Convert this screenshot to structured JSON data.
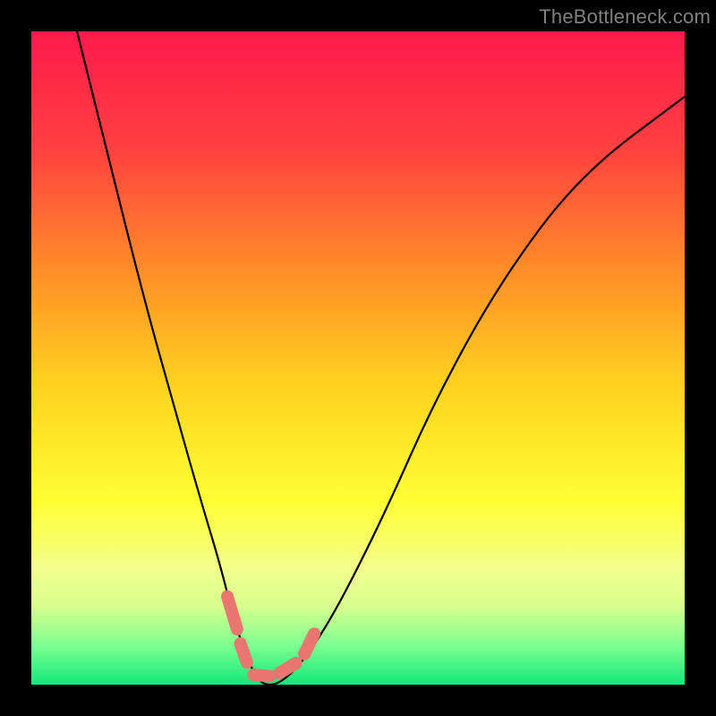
{
  "watermark": "TheBottleneck.com",
  "chart_data": {
    "type": "line",
    "title": "",
    "xlabel": "",
    "ylabel": "",
    "xlim": [
      0,
      100
    ],
    "ylim": [
      0,
      100
    ],
    "grid": false,
    "legend": false,
    "series": [
      {
        "name": "curve",
        "x": [
          7,
          12,
          17,
          22,
          26,
          29,
          31,
          33,
          35,
          38,
          42,
          47,
          54,
          62,
          72,
          84,
          100
        ],
        "y": [
          100,
          80,
          60,
          42,
          28,
          18,
          10,
          4,
          0,
          0,
          4,
          12,
          26,
          44,
          62,
          78,
          90
        ]
      }
    ],
    "markers": {
      "note": "highlighted pink segments near the curve minimum",
      "segments": [
        {
          "x0": 30.0,
          "y0": 13.5,
          "x1": 31.5,
          "y1": 8.5
        },
        {
          "x0": 32.0,
          "y0": 6.3,
          "x1": 33.0,
          "y1": 3.4
        },
        {
          "x0": 34.0,
          "y0": 1.5,
          "x1": 36.5,
          "y1": 1.3
        },
        {
          "x0": 38.0,
          "y0": 1.8,
          "x1": 40.5,
          "y1": 3.3
        },
        {
          "x0": 41.8,
          "y0": 4.7,
          "x1": 43.3,
          "y1": 7.8
        }
      ]
    },
    "background_gradient": {
      "direction": "top-to-bottom",
      "stops": [
        {
          "pos": 0.0,
          "color": "#ff1a4b"
        },
        {
          "pos": 0.18,
          "color": "#ff4040"
        },
        {
          "pos": 0.36,
          "color": "#ff8b28"
        },
        {
          "pos": 0.54,
          "color": "#ffd21e"
        },
        {
          "pos": 0.72,
          "color": "#ffff33"
        },
        {
          "pos": 0.82,
          "color": "#f3ff8a"
        },
        {
          "pos": 0.88,
          "color": "#d8ff8e"
        },
        {
          "pos": 0.94,
          "color": "#7dff91"
        },
        {
          "pos": 1.0,
          "color": "#12e87a"
        }
      ]
    }
  }
}
